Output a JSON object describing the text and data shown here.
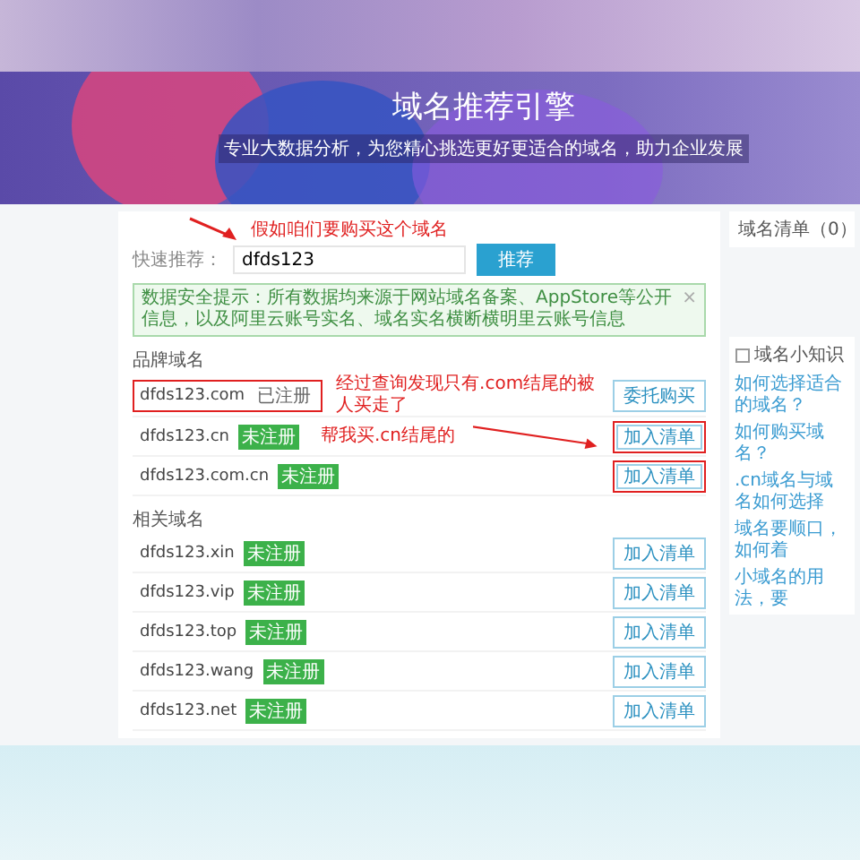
{
  "banner": {
    "title": "域名推荐引擎",
    "subtitle": "专业大数据分析，为您精心挑选更好更适合的域名，助力企业发展"
  },
  "search": {
    "label": "快速推荐：",
    "value": "dfds123",
    "button": "推荐",
    "annotation": "假如咱们要购买这个域名"
  },
  "notice": {
    "text": "数据安全提示：所有数据均来源于网站域名备案、AppStore等公开信息，以及阿里云账号实名、域名实名横断横明里云账号信息",
    "close": "×"
  },
  "sections": [
    {
      "title": "品牌域名",
      "rows": [
        {
          "domain": "dfds123.com",
          "kind": "registered",
          "status": "已注册",
          "action": "委托购买",
          "domain_marked": true,
          "action_marked": false,
          "note": "经过查询发现只有.com结尾的被人买走了"
        },
        {
          "domain": "dfds123.cn",
          "kind": "available",
          "status": "未注册",
          "action": "加入清单",
          "domain_marked": false,
          "action_marked": true,
          "note": "帮我买.cn结尾的",
          "arrow": true
        },
        {
          "domain": "dfds123.com.cn",
          "kind": "available",
          "status": "未注册",
          "action": "加入清单",
          "domain_marked": false,
          "action_marked": true
        }
      ]
    },
    {
      "title": "相关域名",
      "rows": [
        {
          "domain": "dfds123.xin",
          "kind": "available",
          "status": "未注册",
          "action": "加入清单",
          "domain_marked": false,
          "action_marked": false
        },
        {
          "domain": "dfds123.vip",
          "kind": "available",
          "status": "未注册",
          "action": "加入清单",
          "domain_marked": false,
          "action_marked": false
        },
        {
          "domain": "dfds123.top",
          "kind": "available",
          "status": "未注册",
          "action": "加入清单",
          "domain_marked": false,
          "action_marked": false
        },
        {
          "domain": "dfds123.wang",
          "kind": "available",
          "status": "未注册",
          "action": "加入清单",
          "domain_marked": false,
          "action_marked": false
        },
        {
          "domain": "dfds123.net",
          "kind": "available",
          "status": "未注册",
          "action": "加入清单",
          "domain_marked": false,
          "action_marked": false
        }
      ]
    }
  ],
  "sidebar": {
    "cart": "域名清单（0）",
    "tips_title": "域名小知识",
    "tips": [
      "如何选择适合的域名？",
      "如何购买域名？",
      ".cn域名与域名如何选择",
      "域名要顺口，如何着",
      "小域名的用法，要"
    ]
  }
}
